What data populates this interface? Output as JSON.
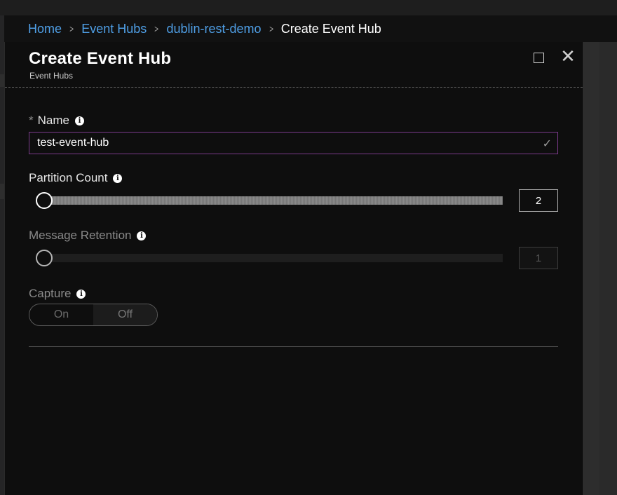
{
  "breadcrumb": {
    "items": [
      {
        "label": "Home"
      },
      {
        "label": "Event Hubs"
      },
      {
        "label": "dublin-rest-demo"
      },
      {
        "label": "Create Event Hub"
      }
    ]
  },
  "blade": {
    "title": "Create Event Hub",
    "subtitle": "Event Hubs"
  },
  "form": {
    "name": {
      "required_marker": "*",
      "label": "Name",
      "value": "test-event-hub",
      "valid": true
    },
    "partition_count": {
      "label": "Partition Count",
      "value": "2",
      "slider_level": 0.0,
      "enabled": true
    },
    "message_retention": {
      "label": "Message Retention",
      "value": "1",
      "slider_level": 0.0,
      "enabled": false
    },
    "capture": {
      "label": "Capture",
      "options": [
        "On",
        "Off"
      ],
      "selected": "Off",
      "enabled": false
    }
  },
  "icons": {
    "info": "info-icon",
    "maximize": "maximize-icon",
    "close": "close-icon",
    "check": "checkmark-icon",
    "chevron": "chevron-right-icon"
  },
  "colors": {
    "link": "#4f9fe6",
    "input_border_focus": "#7a3a8a",
    "background": "#0e0e0e"
  }
}
